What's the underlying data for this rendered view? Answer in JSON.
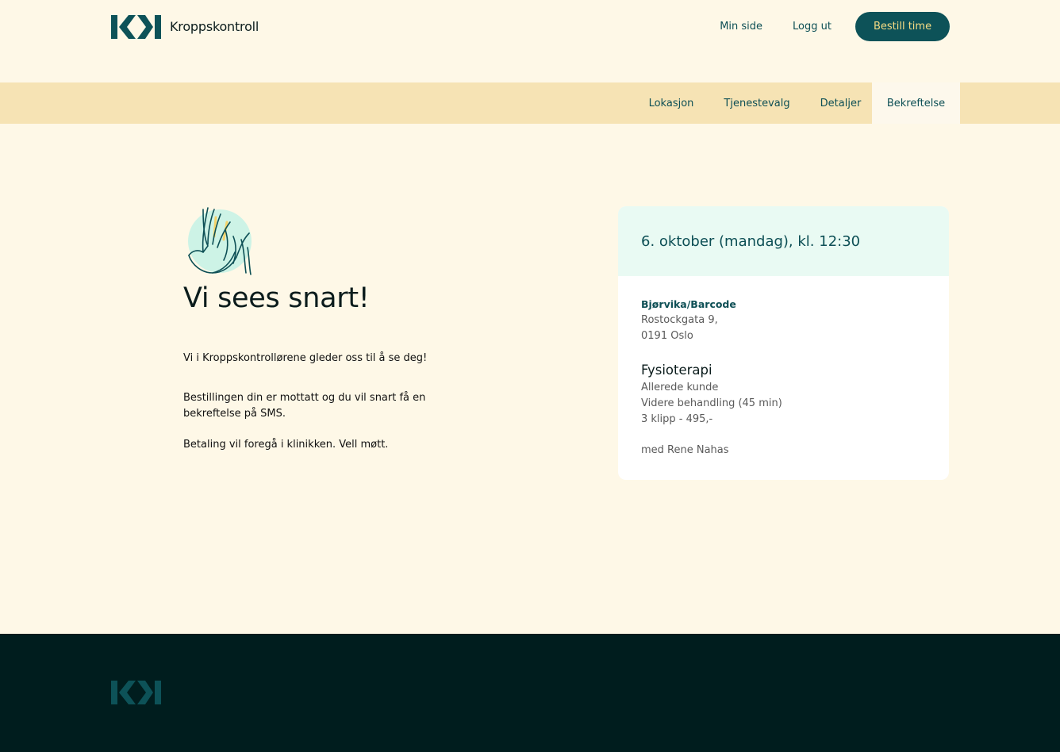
{
  "brand": {
    "name": "Kroppskontroll",
    "color": "#0d5258"
  },
  "header": {
    "nav": [
      {
        "label": "Min side"
      },
      {
        "label": "Logg ut"
      }
    ],
    "cta_label": "Bestill time"
  },
  "steps": [
    {
      "label": "Lokasjon",
      "active": false
    },
    {
      "label": "Tjenestevalg",
      "active": false
    },
    {
      "label": "Detaljer",
      "active": false
    },
    {
      "label": "Bekreftelse",
      "active": true
    }
  ],
  "confirmation": {
    "illustration_icon": "waving-hand-icon",
    "headline": "Vi sees snart!",
    "message_1": "Vi i Kroppskontrollørene gleder oss til å se deg!",
    "message_2": "Bestillingen din er mottatt og du vil snart få en bekreftelse på SMS.",
    "message_3": "Betaling vil foregå i klinikken. Vell møtt."
  },
  "booking": {
    "datetime": "6. oktober (mandag), kl. 12:30",
    "clinic_name": "Bjørvika/Barcode",
    "address_line_1": "Rostockgata 9,",
    "address_line_2": "0191 Oslo",
    "service": "Fysioterapi",
    "customer_type": "Allerede kunde",
    "treatment": "Videre behandling (45 min)",
    "price": "3 klipp - 495,-",
    "practitioner": "med Rene Nahas"
  },
  "colors": {
    "background": "#fef8e7",
    "steps_bar": "#f6e3b4",
    "accent": "#0d5258",
    "cta_text": "#f7dc84",
    "card_header": "#e9faf3",
    "footer": "#001d1e"
  }
}
